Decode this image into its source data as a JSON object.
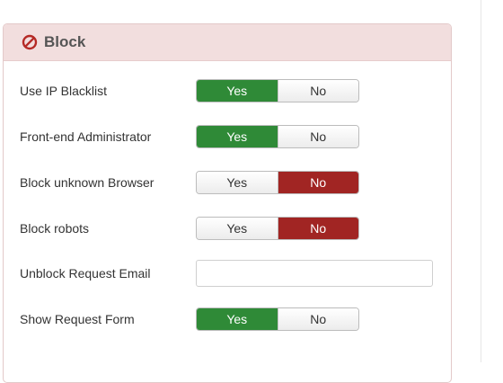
{
  "panel": {
    "title": "Block",
    "icon": "ban-icon",
    "header_color": "#f2dede"
  },
  "colors": {
    "yes_active": "#2f8a37",
    "no_active": "#a12523"
  },
  "fields": {
    "use_ip_blacklist": {
      "label": "Use IP Blacklist",
      "yes": "Yes",
      "no": "No",
      "value": "Yes"
    },
    "frontend_admin": {
      "label": "Front-end Administrator",
      "yes": "Yes",
      "no": "No",
      "value": "Yes"
    },
    "block_unknown_browser": {
      "label": "Block unknown Browser",
      "yes": "Yes",
      "no": "No",
      "value": "No"
    },
    "block_robots": {
      "label": "Block robots",
      "yes": "Yes",
      "no": "No",
      "value": "No"
    },
    "unblock_email": {
      "label": "Unblock Request Email",
      "value": "",
      "placeholder": ""
    },
    "show_request_form": {
      "label": "Show Request Form",
      "yes": "Yes",
      "no": "No",
      "value": "Yes"
    }
  }
}
